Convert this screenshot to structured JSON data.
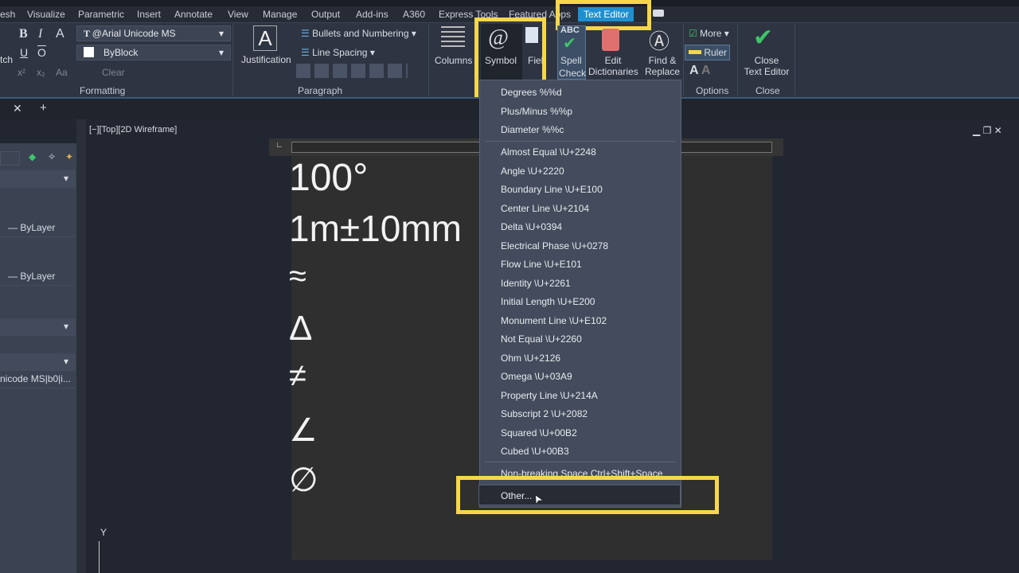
{
  "menubar": {
    "tabs": [
      "esh",
      "Visualize",
      "Parametric",
      "Insert",
      "Annotate",
      "View",
      "Manage",
      "Output",
      "Add-ins",
      "A360",
      "Express Tools",
      "Featured Apps"
    ],
    "active_tab": "Text Editor"
  },
  "ribbon": {
    "formatting": {
      "bold": "B",
      "italic": "I",
      "overline_a": "A",
      "underline": "U",
      "overline": "O",
      "match": "tch",
      "font": "@Arial Unicode MS",
      "color": "ByBlock",
      "clear": "Clear",
      "superscript": "x²",
      "subscript": "x₂",
      "case": "Aa",
      "group": "Formatting"
    },
    "paragraph": {
      "justification": "Justification",
      "bullets": "Bullets and Numbering",
      "line_spacing": "Line Spacing",
      "group": "Paragraph"
    },
    "insert": {
      "columns": "Columns",
      "symbol": "Symbol",
      "field": "Field"
    },
    "spell": {
      "spell_check_1": "Spell",
      "spell_check_2": "Check",
      "edit_dict_1": "Edit",
      "edit_dict_2": "Dictionaries",
      "abc": "ABC"
    },
    "tools": {
      "find_1": "Find &",
      "find_2": "Replace"
    },
    "options": {
      "more": "More",
      "ruler": "Ruler",
      "group": "Options"
    },
    "close": {
      "close_1": "Close",
      "close_2": "Text Editor",
      "group": "Close"
    },
    "accent": "#1e90d0",
    "highlight": "#f7d74a",
    "check_green": "#3ec46a"
  },
  "viewport": {
    "label": "[−][Top][2D Wireframe]",
    "axis_y": "Y"
  },
  "palette": {
    "rows": [
      "— ByLayer",
      "— ByLayer",
      "nicode MS|b0|i..."
    ]
  },
  "canvas": {
    "lines": [
      "100°",
      "1m±10mm",
      "≈",
      "Δ",
      "≠",
      "∠",
      "∅"
    ]
  },
  "symbol_menu": {
    "group1": [
      "Degrees  %%d",
      "Plus/Minus  %%p",
      "Diameter  %%c"
    ],
    "group2": [
      "Almost Equal  \\U+2248",
      "Angle  \\U+2220",
      "Boundary Line  \\U+E100",
      "Center Line  \\U+2104",
      "Delta  \\U+0394",
      "Electrical Phase  \\U+0278",
      "Flow Line  \\U+E101",
      "Identity  \\U+2261",
      "Initial Length  \\U+E200",
      "Monument Line  \\U+E102",
      "Not Equal  \\U+2260",
      "Ohm  \\U+2126",
      "Omega  \\U+03A9",
      "Property Line  \\U+214A",
      "Subscript 2  \\U+2082",
      "Squared  \\U+00B2",
      "Cubed  \\U+00B3"
    ],
    "nbsp": "Non-breaking Space Ctrl+Shift+Space",
    "other": "Other..."
  }
}
